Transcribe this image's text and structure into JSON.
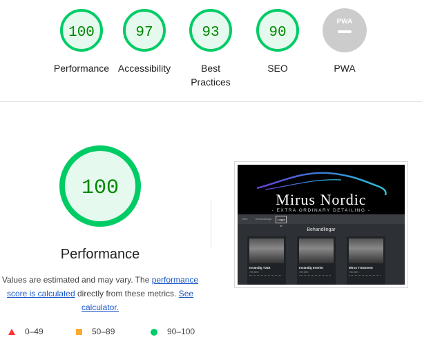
{
  "categories": [
    {
      "label": "Performance",
      "score": "100",
      "value": 100
    },
    {
      "label": "Accessibility",
      "score": "97",
      "value": 97
    },
    {
      "label": "Best Practices",
      "score": "93",
      "value": 93
    },
    {
      "label": "SEO",
      "score": "90",
      "value": 90
    },
    {
      "label": "PWA",
      "score": "",
      "value": null,
      "badge": "PWA"
    }
  ],
  "main": {
    "score": "100",
    "title": "Performance",
    "desc_prefix": "Values are estimated and may vary. The ",
    "link_score": "performance score is calculated",
    "desc_middle": " directly from these metrics. ",
    "link_calc": "See calculator."
  },
  "legend": [
    {
      "range": "0–49",
      "shape": "triangle",
      "color": "#ff3333"
    },
    {
      "range": "50–89",
      "shape": "square",
      "color": "#ffaa33"
    },
    {
      "range": "90–100",
      "shape": "circle",
      "color": "#00cc66"
    }
  ],
  "screenshot": {
    "logo": "Mirus Nordic",
    "tagline": "- EXTRA ORDINARY DETAILING -",
    "nav": [
      "Hem",
      "Behandlingar"
    ],
    "nav_login": "Logga in",
    "section": "Behandlingar",
    "cards": [
      {
        "title": "Invändig Tvätt",
        "price": "795 SEK"
      },
      {
        "title": "Invändig Interiör",
        "price": "795 SEK"
      },
      {
        "title": "Mirus Treatment",
        "price": "795 SEK"
      }
    ]
  },
  "colors": {
    "pass": "#00cc66",
    "pass_bg": "#e6f9ee",
    "pass_text": "#008800",
    "na": "#cccccc"
  }
}
